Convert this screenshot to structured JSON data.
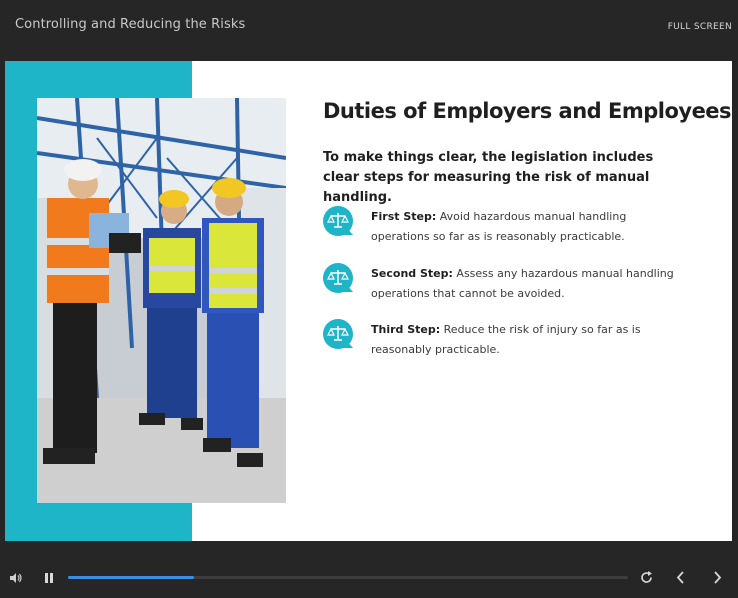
{
  "header": {
    "course_title": "Controlling and Reducing the Risks",
    "fullscreen_label": "FULL SCREEN"
  },
  "slide": {
    "heading": "Duties of Employers and Employees",
    "intro": "To make things clear, the legislation includes clear steps for measuring the risk of manual handling.",
    "steps": [
      {
        "label": "First Step:",
        "text": " Avoid hazardous manual handling operations so far as is reasonably practicable.",
        "icon": "scales-icon"
      },
      {
        "label": "Second Step:",
        "text": " Assess any hazardous manual handling operations that cannot be avoided.",
        "icon": "scales-icon"
      },
      {
        "label": "Third Step:",
        "text": " Reduce the risk of injury so far as is reasonably practicable.",
        "icon": "scales-icon"
      }
    ],
    "photo": "workers-in-hard-hats-photo"
  },
  "player": {
    "progress_fraction": 0.225,
    "icons": [
      "volume-icon",
      "pause-icon",
      "replay-icon",
      "previous-icon",
      "next-icon"
    ]
  },
  "colors": {
    "accent": "#1eb5c8",
    "progress": "#3a8de0",
    "chrome": "#262626"
  }
}
